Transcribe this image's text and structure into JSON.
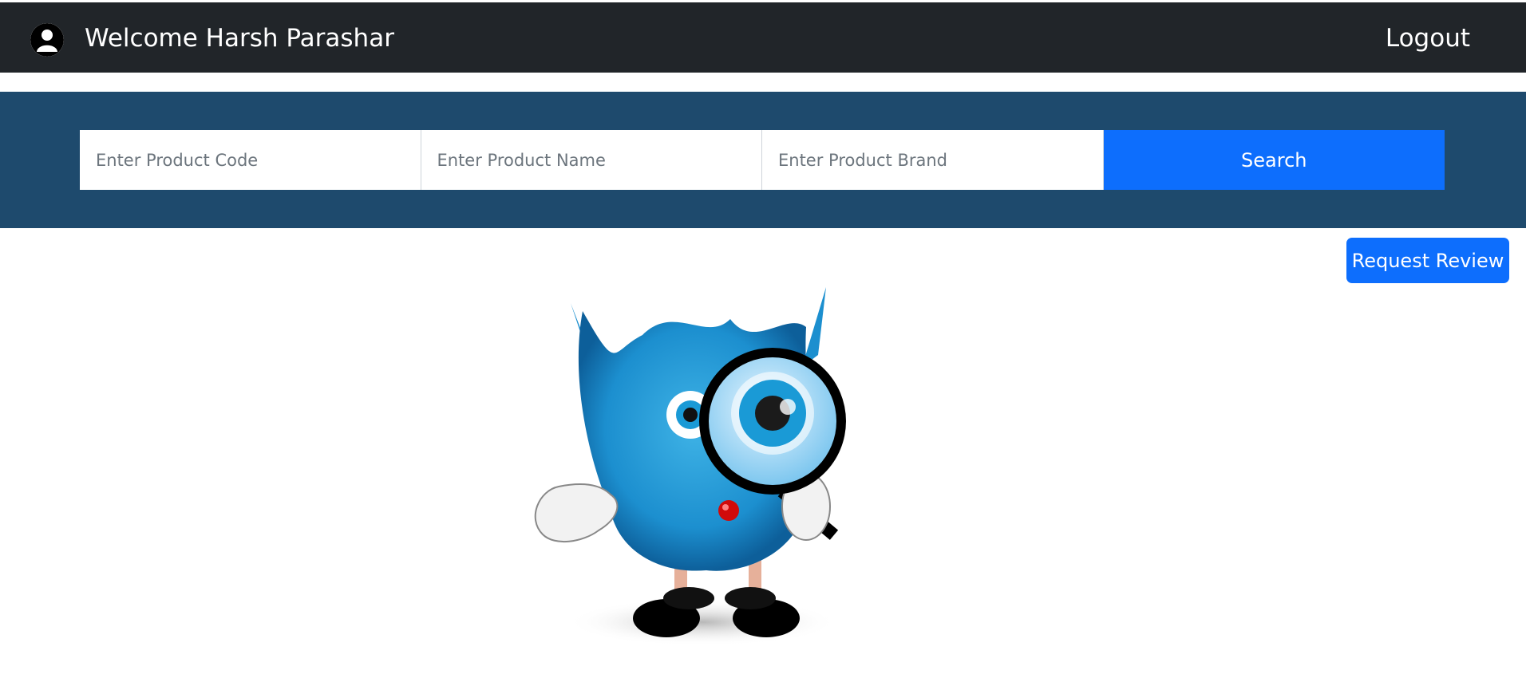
{
  "header": {
    "welcome_text": "Welcome Harsh Parashar",
    "logout_label": "Logout",
    "avatar_icon": "user-icon"
  },
  "search": {
    "code_placeholder": "Enter Product Code",
    "name_placeholder": "Enter Product Name",
    "brand_placeholder": "Enter Product Brand",
    "button_label": "Search"
  },
  "actions": {
    "request_review_label": "Request Review"
  },
  "illustration": {
    "name": "monster-with-magnifier-icon"
  },
  "colors": {
    "navbar": "#212529",
    "search_band": "#1e4a6d",
    "primary": "#0d6efd"
  }
}
